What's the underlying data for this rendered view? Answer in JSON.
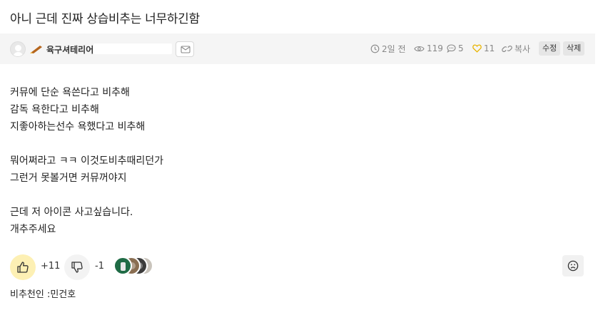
{
  "post": {
    "title": "아니 근데 진짜 상습비추는 너무하긴함",
    "author": {
      "nickname": "육구셔테리어"
    },
    "stats": {
      "time": "2일 전",
      "views": "119",
      "comments": "5",
      "likes": "11",
      "copy_label": "복사"
    },
    "actions": {
      "edit_label": "수정",
      "delete_label": "삭제"
    },
    "body": [
      "커뮤에 단순 욕쓴다고 비추해",
      "감독 욕한다고 비추해",
      "지좋아하는선수 욕했다고 비추해",
      "",
      "뭐어쩌라고 ㅋㅋ 이것도비추때리던가",
      "그런거 못볼거면 커뮤꺼야지",
      "",
      "근데 저 아이콘 사고싶습니다.",
      "개추주세요"
    ],
    "votes": {
      "up_count": "+11",
      "down_count": "-1"
    },
    "recommenders_line": "비추천인 :민건호"
  },
  "icons": {
    "clock": "clock-icon",
    "eye": "eye-icon",
    "comment": "comment-icon",
    "heart": "heart-icon",
    "link": "link-icon",
    "mail": "mail-icon",
    "thumbs_up": "thumbs-up-icon",
    "thumbs_down": "thumbs-down-icon",
    "frown": "frown-icon"
  },
  "colors": {
    "meta_bar_bg": "#f5f5f5",
    "like_bg": "#fdf0b4",
    "heart": "#e8b400",
    "muted_text": "#888888"
  }
}
